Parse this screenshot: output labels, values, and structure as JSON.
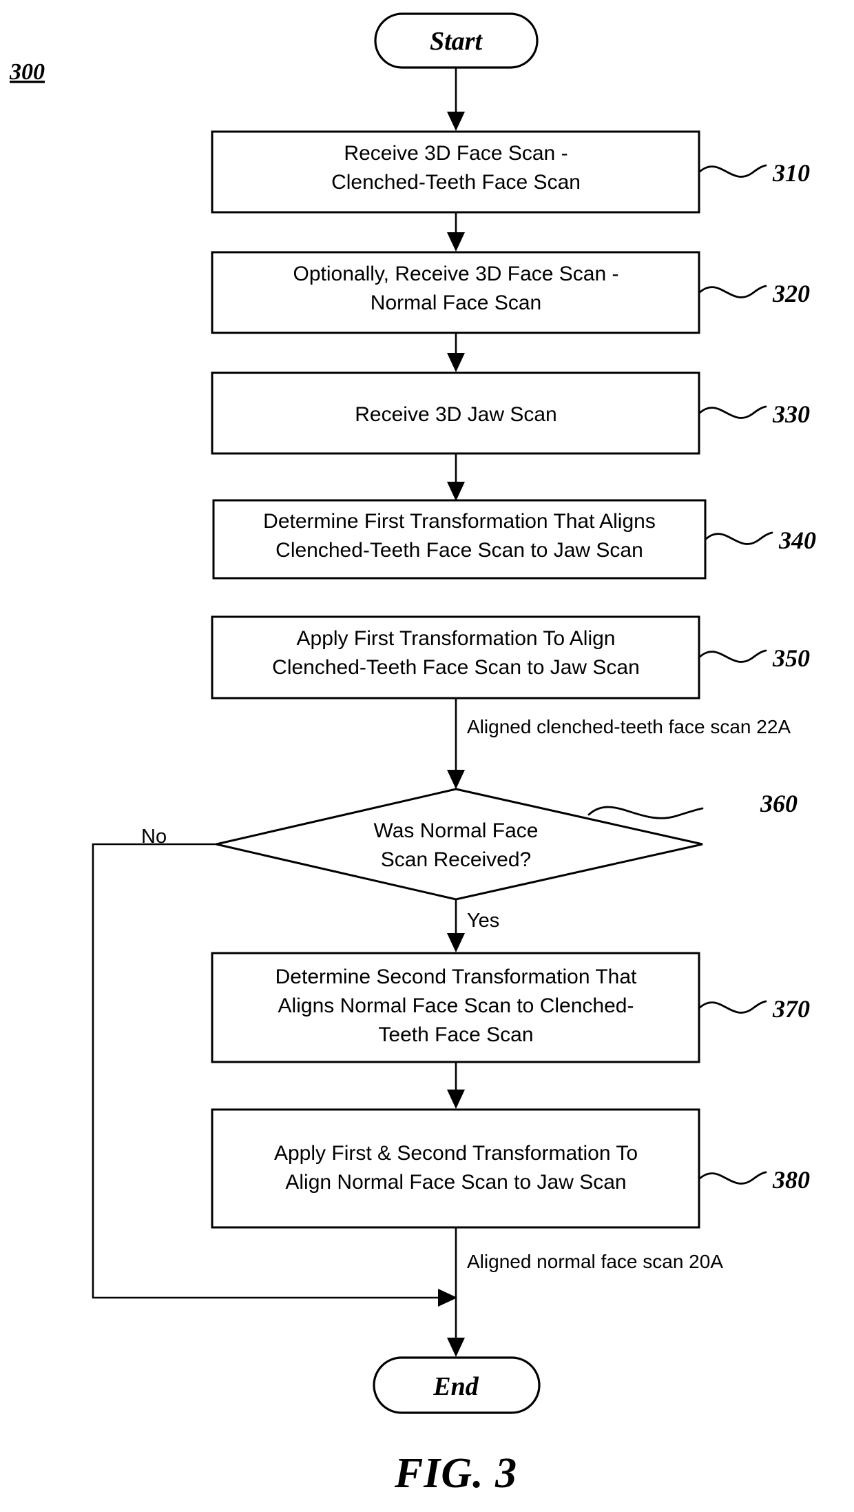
{
  "figure": {
    "number_label": "300",
    "caption": "FIG. 3"
  },
  "terminals": {
    "start": "Start",
    "end": "End"
  },
  "nodes": [
    {
      "id": "310",
      "ref": "310",
      "type": "process",
      "lines": [
        "Receive 3D Face Scan -",
        "Clenched-Teeth Face Scan"
      ]
    },
    {
      "id": "320",
      "ref": "320",
      "type": "process",
      "lines": [
        "Optionally, Receive 3D Face Scan -",
        "Normal Face Scan"
      ]
    },
    {
      "id": "330",
      "ref": "330",
      "type": "process",
      "lines": [
        "Receive 3D Jaw Scan"
      ]
    },
    {
      "id": "340",
      "ref": "340",
      "type": "process",
      "lines": [
        "Determine First Transformation That Aligns",
        "Clenched-Teeth Face Scan to Jaw Scan"
      ]
    },
    {
      "id": "350",
      "ref": "350",
      "type": "process",
      "lines": [
        "Apply First Transformation To Align",
        "Clenched-Teeth Face Scan to Jaw Scan"
      ]
    },
    {
      "id": "360",
      "ref": "360",
      "type": "decision",
      "lines": [
        "Was Normal Face",
        "Scan Received?"
      ]
    },
    {
      "id": "370",
      "ref": "370",
      "type": "process",
      "lines": [
        "Determine Second Transformation That",
        "Aligns Normal Face Scan to Clenched-",
        "Teeth Face Scan"
      ]
    },
    {
      "id": "380",
      "ref": "380",
      "type": "process",
      "lines": [
        "Apply First & Second Transformation To",
        "Align Normal Face Scan to Jaw Scan"
      ]
    }
  ],
  "edge_labels": {
    "after_350": "Aligned clenched-teeth face scan 22A",
    "after_380": "Aligned normal face scan 20A",
    "decision_no": "No",
    "decision_yes": "Yes"
  },
  "colors": {
    "stroke": "#000000",
    "fill": "#ffffff",
    "text": "#000000"
  },
  "chart_data": {
    "type": "diagram",
    "title": "FIG. 3",
    "subtype": "flowchart",
    "node_sequence": [
      "Start",
      "310",
      "320",
      "330",
      "340",
      "350",
      "360",
      "370",
      "380",
      "End"
    ],
    "branches": [
      {
        "from": "360",
        "label": "Yes",
        "to": "370"
      },
      {
        "from": "360",
        "label": "No",
        "to": "End"
      }
    ]
  }
}
